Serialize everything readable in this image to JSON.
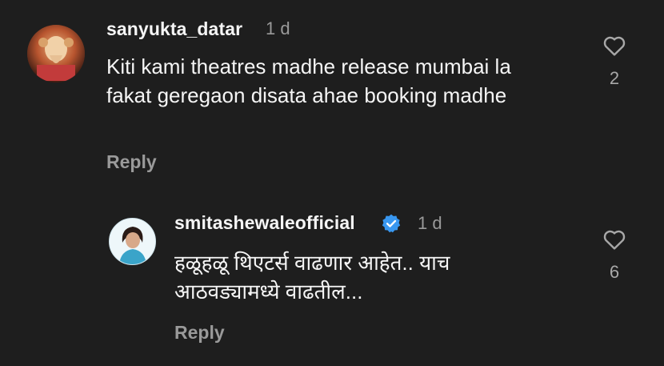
{
  "comments": [
    {
      "username": "sanyukta_datar",
      "time": "1 d",
      "text": "Kiti kami theatres madhe release mumbai la  fakat geregaon disata ahae booking madhe",
      "reply_label": "Reply",
      "likes": "2"
    },
    {
      "username": "smitashewaleofficial",
      "time": "1 d",
      "text": "हळूहळू थिएटर्स वाढणार आहेत.. याच आठवड्यामध्ये वाढतील...",
      "reply_label": "Reply",
      "likes": "6",
      "verified": true
    }
  ],
  "icons": {
    "like": "heart-outline-icon",
    "verified": "verified-badge-icon"
  },
  "colors": {
    "background": "#1e1e1e",
    "verified_blue": "#3897f0"
  }
}
